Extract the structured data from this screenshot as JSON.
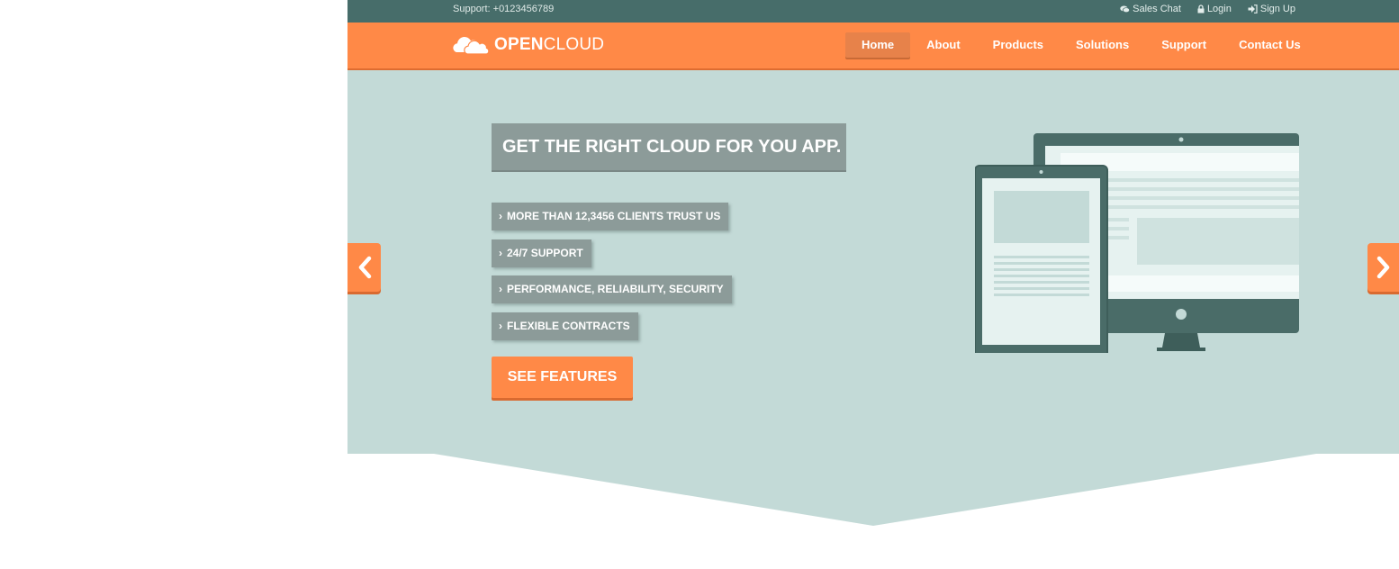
{
  "topbar": {
    "support": "Support: +0123456789",
    "links": [
      {
        "label": "Sales Chat",
        "icon": "chat-icon"
      },
      {
        "label": "Login",
        "icon": "lock-icon"
      },
      {
        "label": "Sign Up",
        "icon": "sign-in-icon"
      }
    ]
  },
  "brand": {
    "logo_open": "OPEN",
    "logo_cloud": "CLOUD",
    "icon": "cloud-icon"
  },
  "nav": {
    "items": [
      "Home",
      "About",
      "Products",
      "Solutions",
      "Support",
      "Contact Us"
    ],
    "active": "Home"
  },
  "hero": {
    "headline": "GET THE RIGHT CLOUD FOR YOU APP.",
    "features": [
      "MORE THAN 12,3456 CLIENTS TRUST US",
      "24/7 SUPPORT",
      "PERFORMANCE, RELIABILITY, SECURITY",
      "FLEXIBLE CONTRACTS"
    ],
    "cta": "SEE FEATURES",
    "prev_icon": "chevron-left-icon",
    "next_icon": "chevron-right-icon",
    "illustration": "tablet-and-monitor-illustration"
  },
  "colors": {
    "accent": "#ff8947",
    "topbar": "#476d6a",
    "hero_bg": "#c3dad7",
    "badge": "#8c9b99",
    "device": "#4a6c68"
  }
}
